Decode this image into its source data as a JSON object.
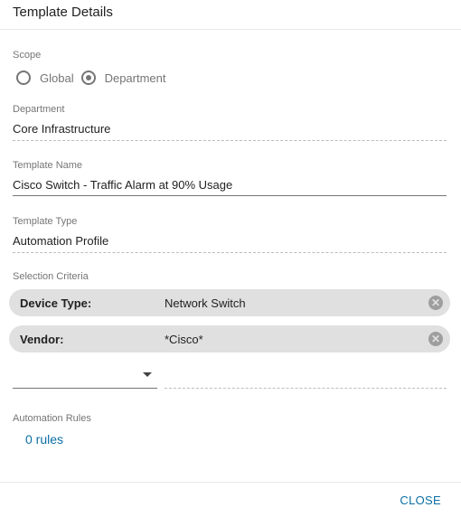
{
  "dialog": {
    "title": "Template Details",
    "close_label": "CLOSE"
  },
  "scope": {
    "caption": "Scope",
    "options": [
      "Global",
      "Department"
    ],
    "selected": "Department"
  },
  "department": {
    "caption": "Department",
    "value": "Core Infrastructure"
  },
  "template_name": {
    "caption": "Template Name",
    "value": "Cisco Switch - Traffic Alarm at 90% Usage"
  },
  "template_type": {
    "caption": "Template Type",
    "value": "Automation Profile"
  },
  "selection_criteria": {
    "caption": "Selection Criteria",
    "chips": [
      {
        "key": "Device Type:",
        "value": "Network Switch"
      },
      {
        "key": "Vendor:",
        "value": "*Cisco*"
      }
    ],
    "new_criteria_value": ""
  },
  "automation_rules": {
    "caption": "Automation Rules",
    "link": "0 rules"
  },
  "icons": {
    "chip_remove": "close-circle-icon",
    "dropdown": "arrow-drop-down-icon"
  }
}
